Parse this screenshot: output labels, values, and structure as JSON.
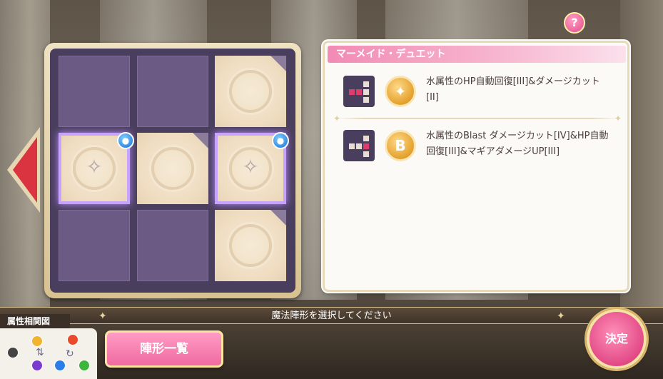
{
  "help": {
    "label": "?"
  },
  "formation": {
    "title": "マーメイド・デュエット",
    "skills": [
      {
        "text": "水属性のHP自動回復[III]&ダメージカット[II]",
        "badge": "✦"
      },
      {
        "text": "水属性のBlast ダメージカット[IV]&HP自動回復[III]&マギアダメージUP[III]",
        "badge": "B"
      }
    ]
  },
  "instruction": "魔法陣形を選択してください",
  "attribute_chart": {
    "label": "属性相関図"
  },
  "buttons": {
    "list": "陣形一覧",
    "decide": "決定"
  },
  "grid": {
    "rows": [
      [
        "empty",
        "empty",
        "filled"
      ],
      [
        "highlight",
        "filled",
        "highlight"
      ],
      [
        "empty",
        "empty",
        "filled"
      ]
    ]
  },
  "icons": {
    "help": "question-icon",
    "water_drop": "water-drop-icon",
    "swirl": "swirl-sparkle-icon"
  }
}
